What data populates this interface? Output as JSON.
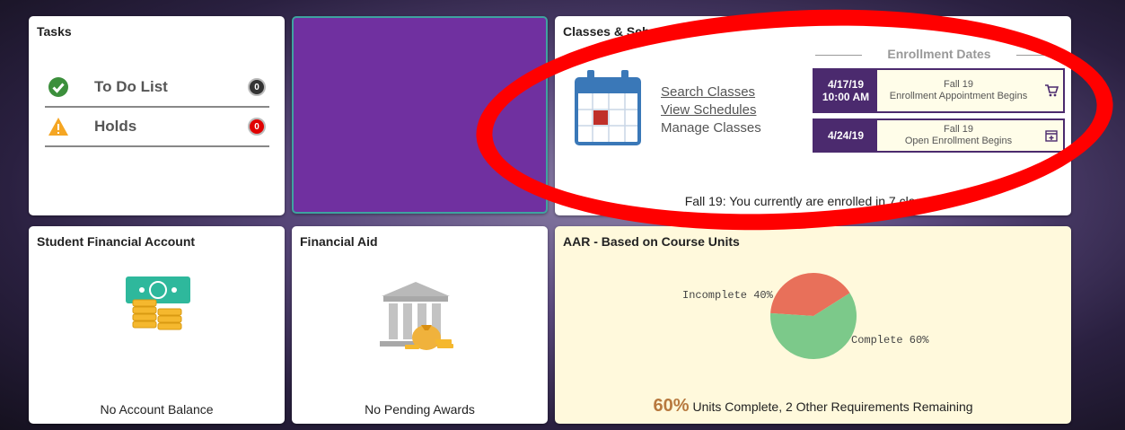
{
  "tasks": {
    "title": "Tasks",
    "items": [
      {
        "label": "To Do List",
        "count": "0",
        "badge_color": "#333333",
        "icon": "check-circle-icon"
      },
      {
        "label": "Holds",
        "count": "0",
        "badge_color": "#e00000",
        "icon": "warning-triangle-icon"
      }
    ]
  },
  "classes": {
    "title": "Classes & Schedules",
    "links": [
      "Search Classes",
      "View Schedules",
      "Manage Classes"
    ],
    "enrollment_header": "Enrollment Dates",
    "enrollments": [
      {
        "date": "4/17/19",
        "time": "10:00 AM",
        "term": "Fall 19",
        "desc": "Enrollment Appointment Begins",
        "icon": "cart-icon"
      },
      {
        "date": "4/24/19",
        "time": "",
        "term": "Fall 19",
        "desc": "Open Enrollment Begins",
        "icon": "calendar-add-icon"
      }
    ],
    "status": "Fall 19: You currently are enrolled in 7 classes"
  },
  "sfa": {
    "title": "Student Financial Account",
    "footer": "No Account Balance",
    "icon": "money-coins-icon"
  },
  "aid": {
    "title": "Financial Aid",
    "footer": "No Pending Awards",
    "icon": "bank-moneybag-icon"
  },
  "aar": {
    "title": "AAR - Based on Course Units",
    "pct": "60%",
    "footer": "Units Complete, 2 Other Requirements Remaining",
    "incomplete_label": "Incomplete 40%",
    "complete_label": "Complete 60%"
  },
  "colors": {
    "accent_purple": "#4b2a6e",
    "tile_purple": "#7030a0",
    "highlight": "#ff0000"
  },
  "chart_data": {
    "type": "pie",
    "categories": [
      "Incomplete",
      "Complete"
    ],
    "values": [
      40,
      60
    ],
    "colors": [
      "#e8705a",
      "#7cc98a"
    ]
  }
}
